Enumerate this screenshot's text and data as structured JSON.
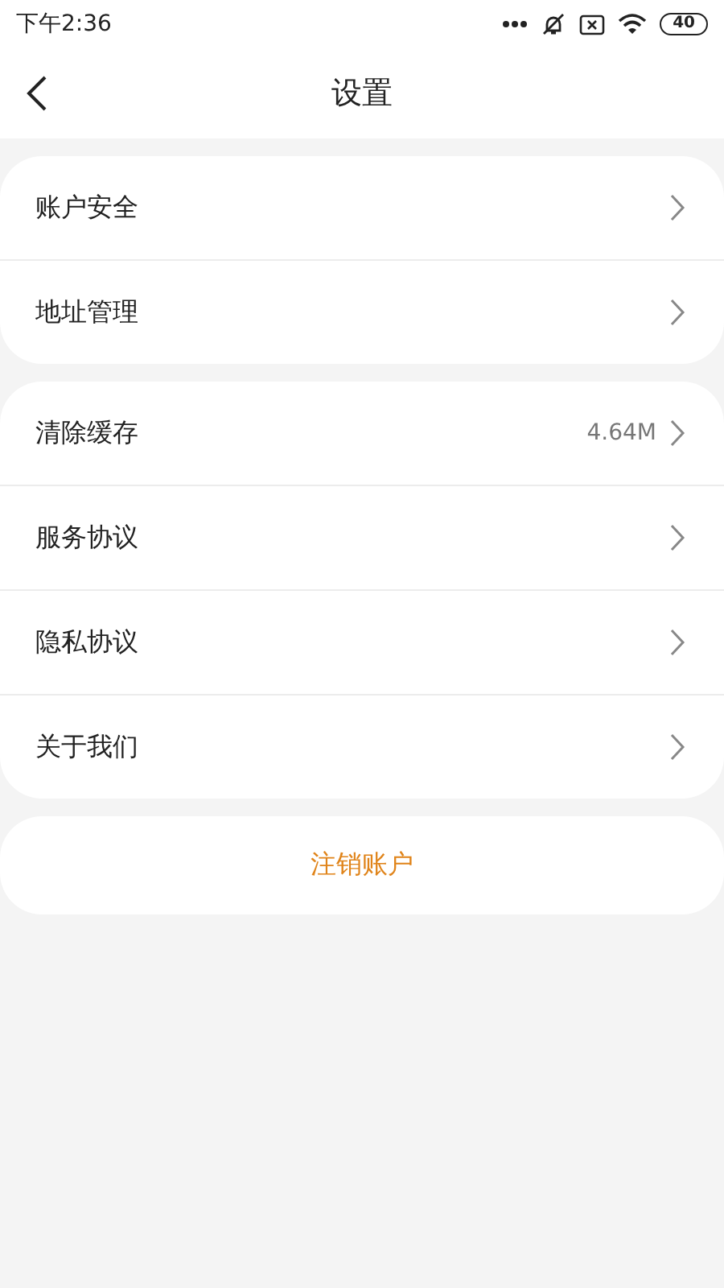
{
  "status_bar": {
    "time": "下午2:36",
    "battery": "40"
  },
  "header": {
    "title": "设置"
  },
  "groups": [
    {
      "items": [
        {
          "label": "账户安全"
        },
        {
          "label": "地址管理"
        }
      ]
    },
    {
      "items": [
        {
          "label": "清除缓存",
          "value": "4.64M"
        },
        {
          "label": "服务协议"
        },
        {
          "label": "隐私协议"
        },
        {
          "label": "关于我们"
        }
      ]
    }
  ],
  "logout_button": {
    "label": "注销账户"
  }
}
